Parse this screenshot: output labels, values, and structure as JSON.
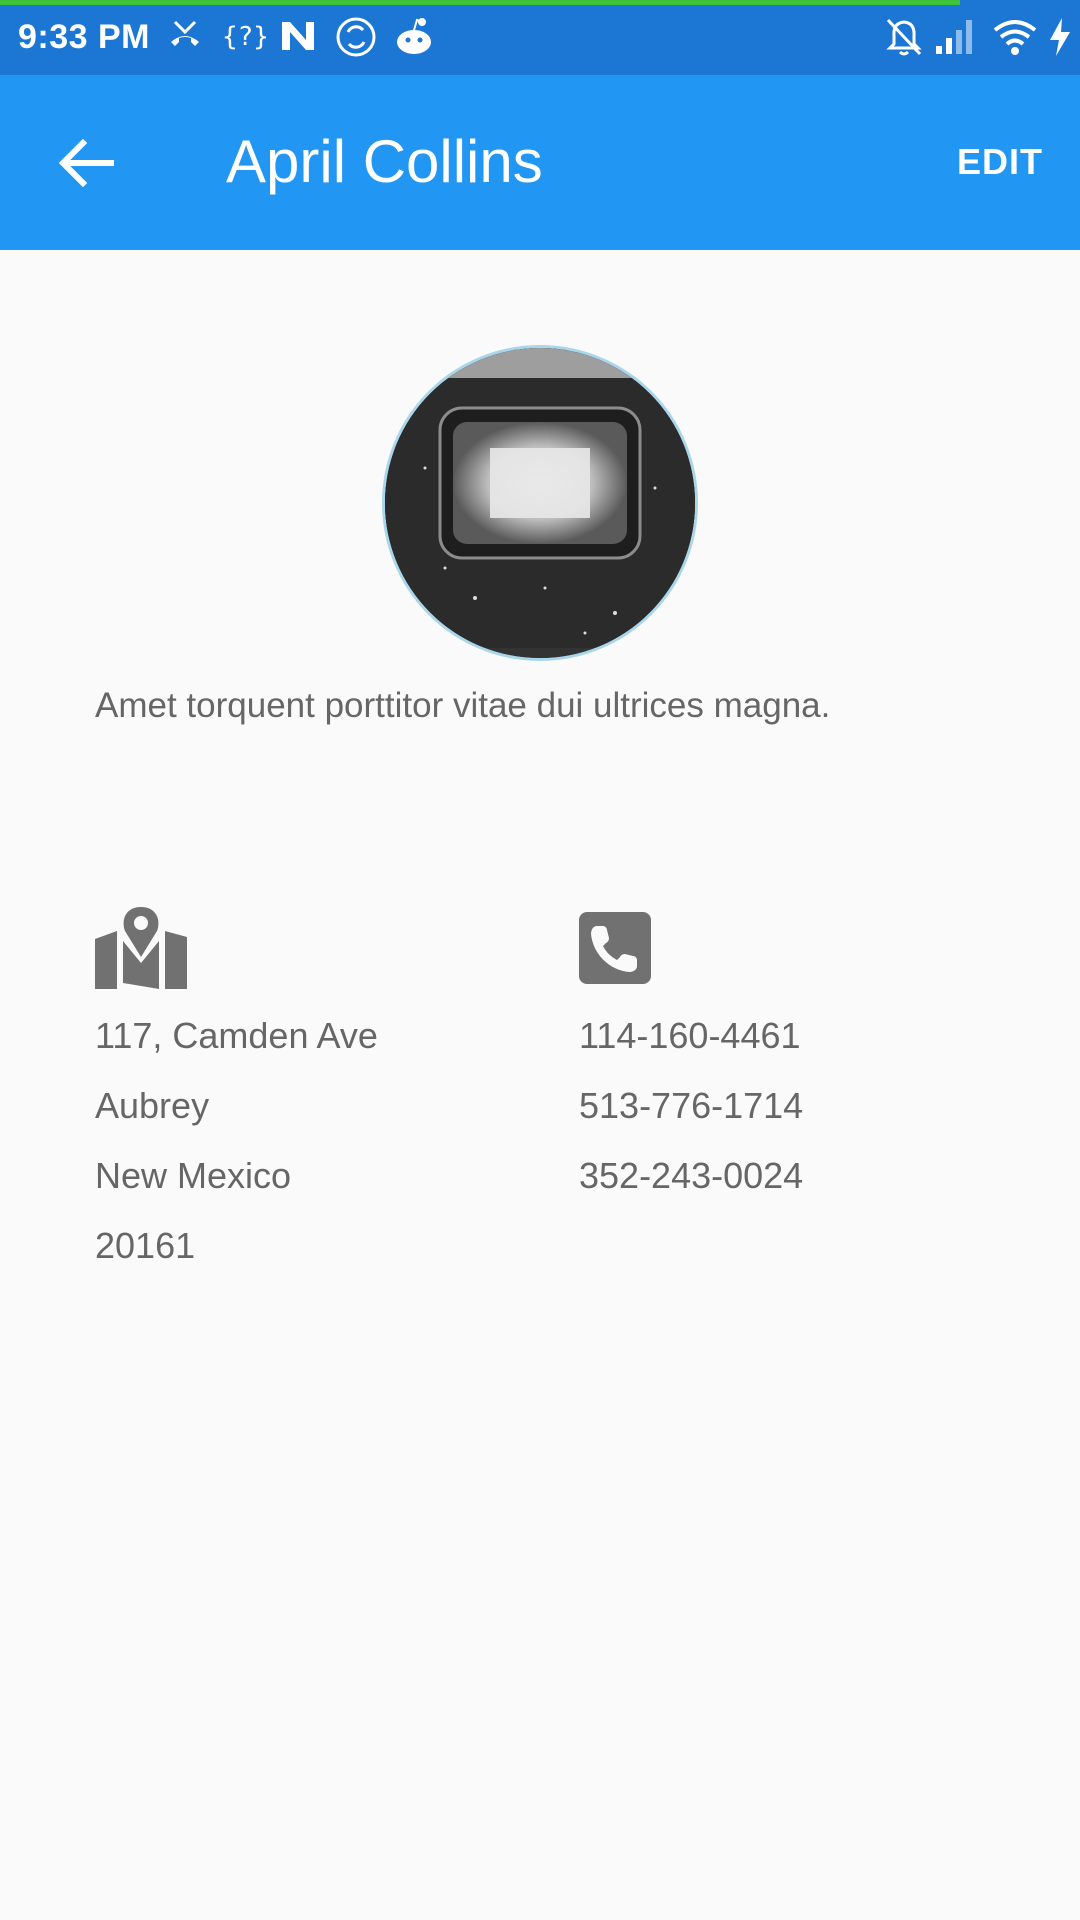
{
  "status_bar": {
    "time": "9:33 PM",
    "icons": [
      "missed-call-icon",
      "unknown-icon",
      "n-icon",
      "sync-icon",
      "reddit-icon",
      "bell-off-icon",
      "signal-icon",
      "wifi-icon",
      "charging-icon"
    ]
  },
  "app_bar": {
    "title": "April Collins",
    "edit_label": "EDIT",
    "back_icon": "arrow-back-icon"
  },
  "profile": {
    "description": "Amet torquent porttitor vitae dui ultrices magna."
  },
  "address": {
    "icon": "map-icon",
    "lines": [
      "117, Camden Ave",
      "Aubrey",
      "New Mexico",
      "20161"
    ]
  },
  "phones": {
    "icon": "phone-icon",
    "numbers": [
      "114-160-4461",
      "513-776-1714",
      "352-243-0024"
    ]
  },
  "colors": {
    "app_bar": "#2196f3",
    "status_bar": "#1c77d4",
    "text": "#666666",
    "icon": "#717171"
  }
}
